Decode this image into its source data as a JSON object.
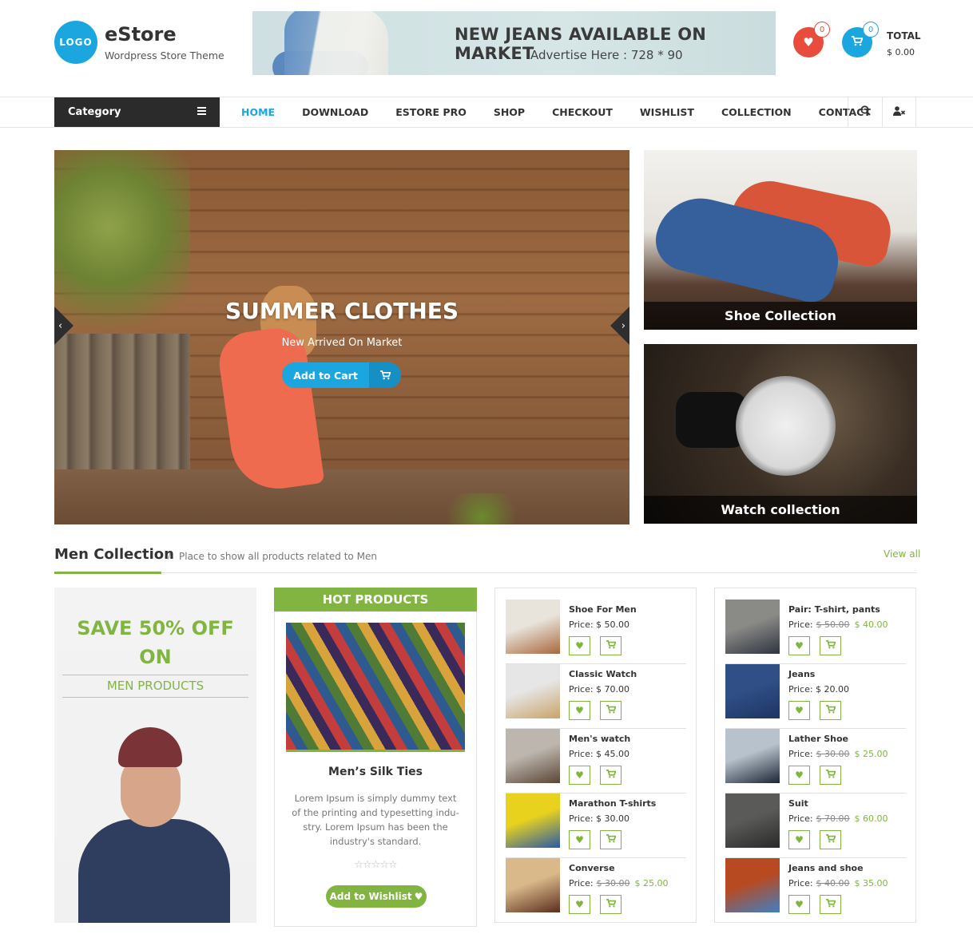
{
  "header": {
    "logo_text": "LOGO",
    "site_title": "eStore",
    "tagline": "Wordpress Store Theme",
    "banner": {
      "title": "NEW JEANS AVAILABLE ON MARKET",
      "subtitle": "Advertise Here : 728 * 90"
    },
    "wishlist": {
      "icon": "heart-icon",
      "count": "0",
      "color": "#e74c3c"
    },
    "cart": {
      "icon": "cart-icon",
      "count": "0",
      "color": "#1ca6df"
    },
    "total_label": "TOTAL",
    "total_value": "$ 0.00"
  },
  "nav": {
    "category_label": "Category",
    "category_icon": "hamburger-icon",
    "items": [
      {
        "label": "HOME",
        "active": true
      },
      {
        "label": "DOWNLOAD"
      },
      {
        "label": "ESTORE PRO"
      },
      {
        "label": "SHOP"
      },
      {
        "label": "CHECKOUT"
      },
      {
        "label": "WISHLIST"
      },
      {
        "label": "COLLECTION"
      },
      {
        "label": "CONTACT"
      }
    ],
    "search_icon": "🔍",
    "user_icon": "user-x-icon"
  },
  "slider": {
    "title": "SUMMER CLOTHES",
    "subtitle": "New Arrived On Market",
    "button_label": "Add to Cart",
    "prev_icon": "‹",
    "next_icon": "›"
  },
  "promos": [
    {
      "caption": "Shoe Collection"
    },
    {
      "caption": "Watch collection"
    }
  ],
  "section": {
    "title": "Men Collection",
    "separator": "/",
    "description": "Place to show all products related to Men",
    "view_all": "View all"
  },
  "save_promo": {
    "line1": "SAVE 50% OFF",
    "line2": "ON",
    "subtitle": "MEN PRODUCTS"
  },
  "hot_products": {
    "heading": "HOT PRODUCTS",
    "product_name": "Men’s Silk Ties",
    "description": "Lorem Ipsum is simply dummy text of the printing and typesetting indu-stry. Lorem Ipsum has been the industry's standard.",
    "rating": 0,
    "rating_max": 5,
    "stars": "☆☆☆☆☆",
    "button_label": "Add to Wishlist",
    "button_icon": "♥"
  },
  "price_label": "Price:",
  "wish_glyph": "♥",
  "cart_glyph": "🛒",
  "product_lists": [
    [
      {
        "name": "Shoe For Men",
        "price": "$ 50.00",
        "old_price": null,
        "thumb": [
          "#e8e4dc",
          "#a9673d"
        ]
      },
      {
        "name": "Classic Watch",
        "price": "$ 70.00",
        "old_price": null,
        "thumb": [
          "#e6e6e6",
          "#c9a36a"
        ]
      },
      {
        "name": "Men's watch",
        "price": "$ 45.00",
        "old_price": null,
        "thumb": [
          "#bdb6ae",
          "#5a4636"
        ]
      },
      {
        "name": "Marathon T-shirts",
        "price": "$ 30.00",
        "old_price": null,
        "thumb": [
          "#e9d21e",
          "#2a5aa5"
        ]
      },
      {
        "name": "Converse",
        "price": "$ 25.00",
        "old_price": "$ 30.00",
        "thumb": [
          "#d9b88a",
          "#5a2e1c"
        ]
      }
    ],
    [
      {
        "name": "Pair: T-shirt, pants",
        "price": "$ 40.00",
        "old_price": "$ 50.00",
        "thumb": [
          "#8a8a86",
          "#2e3440"
        ]
      },
      {
        "name": "Jeans",
        "price": "$ 20.00",
        "old_price": null,
        "thumb": [
          "#2f4f86",
          "#1e3463"
        ]
      },
      {
        "name": "Lather Shoe",
        "price": "$ 25.00",
        "old_price": "$ 30.00",
        "thumb": [
          "#b8c2cc",
          "#1d2535"
        ]
      },
      {
        "name": "Suit",
        "price": "$ 60.00",
        "old_price": "$ 70.00",
        "thumb": [
          "#5a5a58",
          "#2a2a28"
        ]
      },
      {
        "name": "Jeans and shoe",
        "price": "$ 35.00",
        "old_price": "$ 40.00",
        "thumb": [
          "#b84a22",
          "#3f7fc4"
        ]
      }
    ]
  ],
  "colors": {
    "accent_green": "#81b441",
    "accent_blue": "#1ca6df",
    "accent_red": "#e74c3c",
    "dark": "#2b2b2b"
  }
}
